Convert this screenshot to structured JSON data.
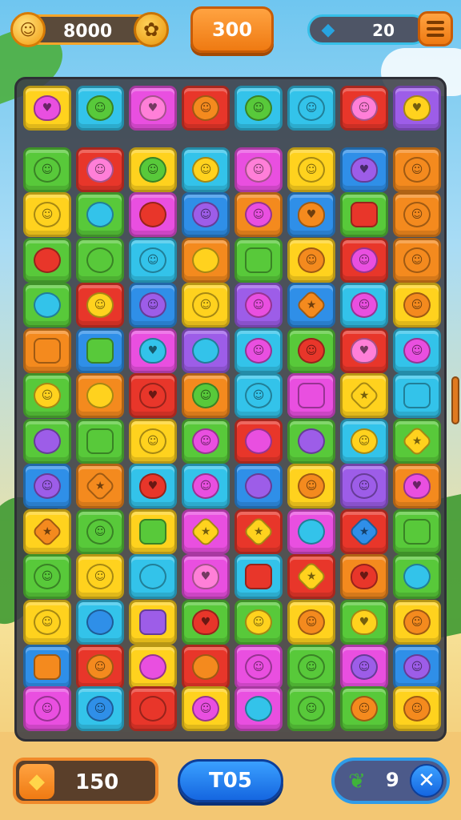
{
  "top_bar": {
    "coins": "8000",
    "score": "300",
    "gems": "20"
  },
  "bottom_bar": {
    "moves": "150",
    "level": "T05",
    "boosters": "9"
  },
  "icons": {
    "coin": "face-coin-icon",
    "settings": "gear-icon",
    "gem": "gem-icon",
    "menu": "menu-icon",
    "moves": "diamond-icon",
    "booster": "leaf-icon",
    "close": "close-icon"
  },
  "colors": {
    "yellow": "#ffd21e",
    "cyan": "#33c3ea",
    "magenta": "#e94fe0",
    "red": "#e8362a",
    "green": "#58c93a",
    "orange": "#f48a1e",
    "purple": "#9d5de8",
    "blue": "#2f8fe8",
    "lime": "#8bd43a"
  },
  "board": {
    "rows": [
      [
        [
          "yellow",
          "magenta",
          "heart"
        ],
        [
          "cyan",
          "green",
          "face"
        ],
        [
          "magenta",
          "pink",
          "heart"
        ],
        [
          "red",
          "orange",
          "face"
        ],
        [
          "cyan",
          "green",
          "face"
        ],
        [
          "cyan",
          "cyan",
          "face"
        ],
        [
          "red",
          "pink",
          "face"
        ],
        [
          "purple",
          "yellow",
          "heart"
        ]
      ],
      [
        [
          "green",
          "green",
          "face"
        ],
        [
          "red",
          "pink",
          "face"
        ],
        [
          "yellow",
          "green",
          "face"
        ],
        [
          "cyan",
          "yellow",
          "face"
        ],
        [
          "magenta",
          "pink",
          "face"
        ],
        [
          "yellow",
          "yellow",
          "face"
        ],
        [
          "blue",
          "purple",
          "heart"
        ],
        [
          "orange",
          "orange",
          "face"
        ]
      ],
      [
        [
          "yellow",
          "yellow",
          "face"
        ],
        [
          "green",
          "cyan",
          "round"
        ],
        [
          "magenta",
          "red",
          "round"
        ],
        [
          "blue",
          "purple",
          "face"
        ],
        [
          "orange",
          "magenta",
          "face"
        ],
        [
          "blue",
          "orange",
          "heart"
        ],
        [
          "green",
          "red",
          "square"
        ],
        [
          "orange",
          "orange",
          "face"
        ]
      ],
      [
        [
          "green",
          "red",
          "round"
        ],
        [
          "green",
          "green",
          "round"
        ],
        [
          "cyan",
          "cyan",
          "face"
        ],
        [
          "orange",
          "yellow",
          "round"
        ],
        [
          "green",
          "green",
          "square"
        ],
        [
          "yellow",
          "orange",
          "face"
        ],
        [
          "red",
          "magenta",
          "face"
        ],
        [
          "orange",
          "orange",
          "face"
        ]
      ],
      [
        [
          "green",
          "cyan",
          "round"
        ],
        [
          "red",
          "yellow",
          "face"
        ],
        [
          "blue",
          "purple",
          "face"
        ],
        [
          "yellow",
          "yellow",
          "face"
        ],
        [
          "purple",
          "magenta",
          "face"
        ],
        [
          "blue",
          "orange",
          "star"
        ],
        [
          "cyan",
          "magenta",
          "face"
        ],
        [
          "yellow",
          "orange",
          "face"
        ]
      ],
      [
        [
          "orange",
          "orange",
          "square"
        ],
        [
          "blue",
          "green",
          "square"
        ],
        [
          "magenta",
          "cyan",
          "heart"
        ],
        [
          "purple",
          "cyan",
          "round"
        ],
        [
          "cyan",
          "magenta",
          "face"
        ],
        [
          "green",
          "red",
          "face"
        ],
        [
          "red",
          "pink",
          "heart"
        ],
        [
          "cyan",
          "magenta",
          "face"
        ]
      ],
      [
        [
          "green",
          "yellow",
          "face"
        ],
        [
          "orange",
          "yellow",
          "round"
        ],
        [
          "red",
          "red",
          "heart"
        ],
        [
          "orange",
          "green",
          "face"
        ],
        [
          "cyan",
          "cyan",
          "face"
        ],
        [
          "magenta",
          "magenta",
          "square"
        ],
        [
          "yellow",
          "yellow",
          "star"
        ],
        [
          "cyan",
          "cyan",
          "square"
        ]
      ],
      [
        [
          "green",
          "purple",
          "round"
        ],
        [
          "green",
          "green",
          "square"
        ],
        [
          "yellow",
          "yellow",
          "face"
        ],
        [
          "green",
          "magenta",
          "face"
        ],
        [
          "red",
          "magenta",
          "round"
        ],
        [
          "green",
          "purple",
          "round"
        ],
        [
          "cyan",
          "yellow",
          "face"
        ],
        [
          "green",
          "yellow",
          "star"
        ]
      ],
      [
        [
          "blue",
          "purple",
          "face"
        ],
        [
          "orange",
          "orange",
          "star"
        ],
        [
          "cyan",
          "red",
          "heart"
        ],
        [
          "cyan",
          "magenta",
          "face"
        ],
        [
          "blue",
          "purple",
          "round"
        ],
        [
          "yellow",
          "orange",
          "face"
        ],
        [
          "purple",
          "purple",
          "face"
        ],
        [
          "orange",
          "magenta",
          "heart"
        ]
      ],
      [
        [
          "yellow",
          "orange",
          "star"
        ],
        [
          "green",
          "green",
          "face"
        ],
        [
          "yellow",
          "green",
          "square"
        ],
        [
          "magenta",
          "yellow",
          "star"
        ],
        [
          "red",
          "yellow",
          "star"
        ],
        [
          "magenta",
          "cyan",
          "round"
        ],
        [
          "red",
          "blue",
          "star"
        ],
        [
          "green",
          "green",
          "square"
        ]
      ],
      [
        [
          "green",
          "green",
          "face"
        ],
        [
          "yellow",
          "yellow",
          "face"
        ],
        [
          "cyan",
          "cyan",
          "round"
        ],
        [
          "magenta",
          "pink",
          "heart"
        ],
        [
          "cyan",
          "red",
          "square"
        ],
        [
          "red",
          "yellow",
          "star"
        ],
        [
          "orange",
          "red",
          "heart"
        ],
        [
          "green",
          "cyan",
          "round"
        ]
      ],
      [
        [
          "yellow",
          "yellow",
          "face"
        ],
        [
          "cyan",
          "blue",
          "round"
        ],
        [
          "yellow",
          "purple",
          "square"
        ],
        [
          "green",
          "red",
          "heart"
        ],
        [
          "green",
          "yellow",
          "face"
        ],
        [
          "yellow",
          "orange",
          "face"
        ],
        [
          "green",
          "yellow",
          "heart"
        ],
        [
          "yellow",
          "orange",
          "face"
        ]
      ],
      [
        [
          "blue",
          "orange",
          "square"
        ],
        [
          "red",
          "orange",
          "face"
        ],
        [
          "yellow",
          "magenta",
          "round"
        ],
        [
          "red",
          "orange",
          "round"
        ],
        [
          "magenta",
          "magenta",
          "face"
        ],
        [
          "green",
          "green",
          "face"
        ],
        [
          "magenta",
          "purple",
          "face"
        ],
        [
          "blue",
          "purple",
          "face"
        ]
      ]
    ],
    "bottom_row": [
      [
        "magenta",
        "magenta",
        "face"
      ],
      [
        "cyan",
        "blue",
        "face"
      ],
      [
        "red",
        "red",
        "round"
      ],
      [
        "yellow",
        "magenta",
        "face"
      ],
      [
        "magenta",
        "cyan",
        "round"
      ],
      [
        "green",
        "green",
        "face"
      ],
      [
        "green",
        "orange",
        "face"
      ],
      [
        "yellow",
        "orange",
        "face"
      ]
    ]
  }
}
